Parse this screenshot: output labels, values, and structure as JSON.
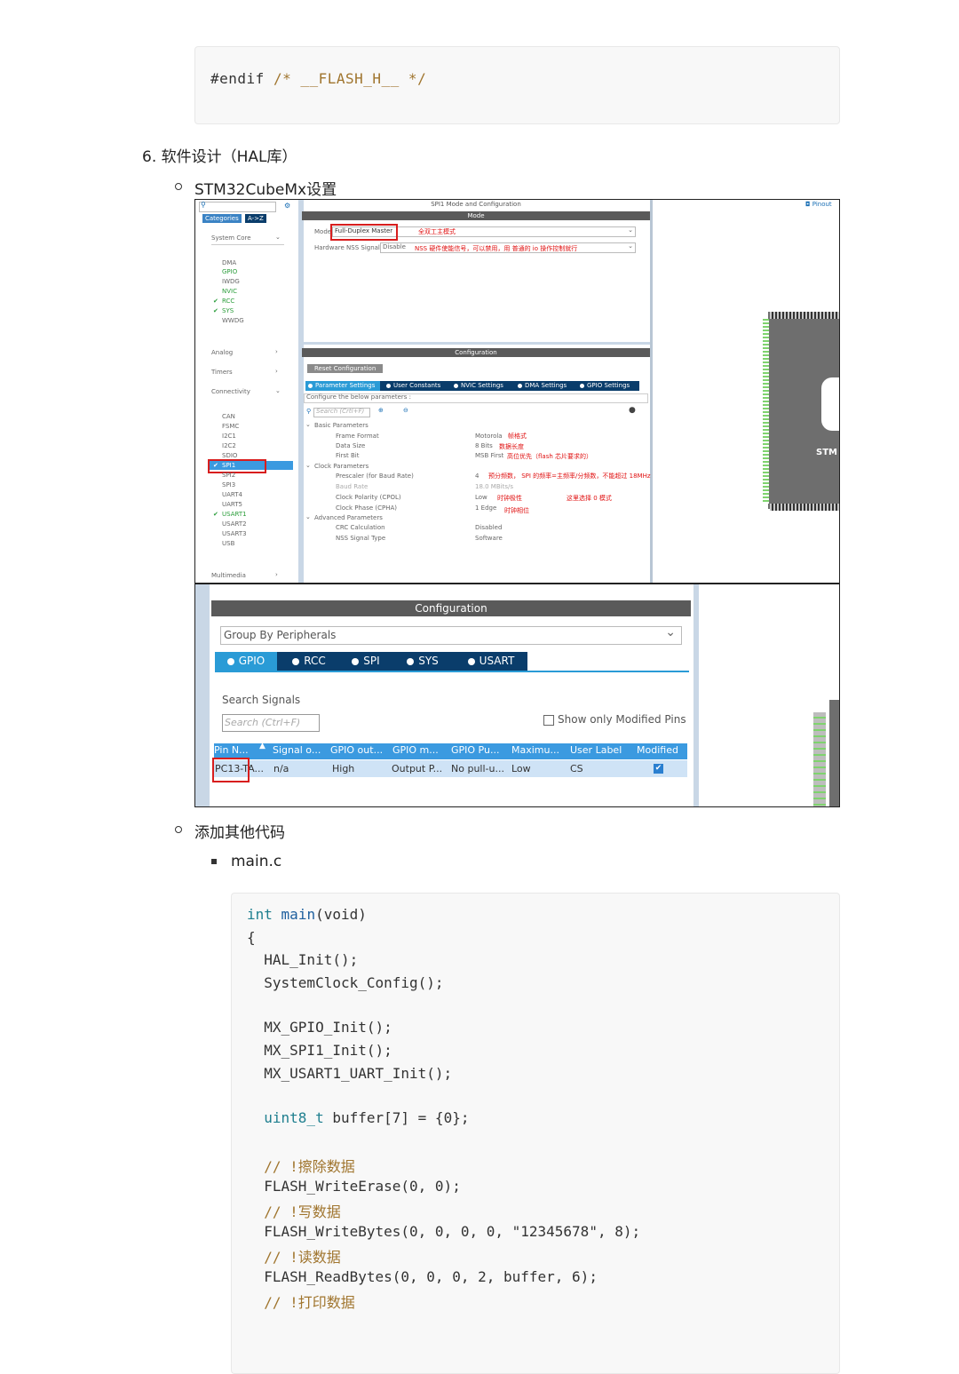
{
  "top_code": {
    "line": "#endif /* __FLASH_H__ */",
    "kw": "#endif",
    "comment": "/* __FLASH_H__ */"
  },
  "section": {
    "title": "6. 软件设计（HAL库）"
  },
  "sub1": {
    "label": "STM32CubeMx设置"
  },
  "shot1": {
    "search_icon": "search-icon",
    "cat_tabs": [
      "Categories",
      "A->Z"
    ],
    "groups": [
      "System Core",
      "Analog",
      "Timers",
      "Connectivity",
      "Multimedia"
    ],
    "system_core_items": [
      "DMA",
      "GPIO",
      "IWDG",
      "NVIC",
      "RCC",
      "SYS",
      "WWDG"
    ],
    "connectivity_items": [
      "CAN",
      "FSMC",
      "I2C1",
      "I2C2",
      "SDIO",
      "SPI1",
      "SPI2",
      "SPI3",
      "UART4",
      "UART5",
      "USART1",
      "USART2",
      "USART3",
      "USB"
    ],
    "mode_title": "SPI1 Mode and Configuration",
    "mode_header": "Mode",
    "mode_label": "Mode",
    "mode_value": "Full-Duplex Master",
    "mode_note": "全双工主模式",
    "nss_label": "Hardware NSS Signal",
    "nss_value": "Disable",
    "nss_note": "NSS 硬件使能信号，可以禁用，用 普通的 io 操作控制就行",
    "config_header": "Configuration",
    "reset_btn": "Reset Configuration",
    "param_tabs": [
      "Parameter Settings",
      "User Constants",
      "NVIC Settings",
      "DMA Settings",
      "GPIO Settings"
    ],
    "configure_text": "Configure the below parameters :",
    "search_placeholder": "Search (Crtl+F)",
    "params": {
      "basic": "Basic Parameters",
      "frame_format": "Frame Format",
      "frame_format_v": "Motorola",
      "frame_format_n": "帧格式",
      "data_size": "Data Size",
      "data_size_v": "8 Bits",
      "data_size_n": "数据长度",
      "first_bit": "First Bit",
      "first_bit_v": "MSB First",
      "first_bit_n": "高位优先（flash 芯片要求的）",
      "clock": "Clock Parameters",
      "prescaler": "Prescaler (for Baud Rate)",
      "prescaler_v": "4",
      "prescaler_n": "预分频数，  SPI 的频率=主频率/分频数，不能超过 18MHz",
      "baud": "Baud Rate",
      "baud_v": "18.0 MBits/s",
      "cpol": "Clock Polarity (CPOL)",
      "cpol_v": "Low",
      "cpol_n": "时钟极性",
      "cpha": "Clock Phase (CPHA)",
      "cpha_v": "1 Edge",
      "cpha_n": "时钟相位",
      "mode0_n": "这里选择 0 模式",
      "advanced": "Advanced Parameters",
      "crc": "CRC Calculation",
      "crc_v": "Disabled",
      "nss_type": "NSS Signal Type",
      "nss_type_v": "Software"
    },
    "pinout": "Pinout",
    "chip_text": "STM"
  },
  "shot2": {
    "header": "Configuration",
    "group_by": "Group By Peripherals",
    "tabs": [
      "GPIO",
      "RCC",
      "SPI",
      "SYS",
      "USART"
    ],
    "search_label": "Search Signals",
    "search_placeholder": "Search (Ctrl+F)",
    "show_modified": "Show only Modified Pins",
    "columns": [
      "Pin N...",
      "Signal o...",
      "GPIO out...",
      "GPIO m...",
      "GPIO Pu...",
      "Maximu...",
      "User Label",
      "Modified"
    ],
    "row": [
      "PC13-TA...",
      "n/a",
      "High",
      "Output P...",
      "No pull-u...",
      "Low",
      "CS",
      ""
    ]
  },
  "sub2": {
    "label": "添加其他代码"
  },
  "sub3": {
    "label": "main.c"
  },
  "main_code": {
    "l1_kw": "int",
    "l1_fn": "main",
    "l1_rest": "(void)",
    "l2": "{",
    "l3": "  HAL_Init();",
    "l4": "  SystemClock_Config();",
    "l5": "  MX_GPIO_Init();",
    "l6": "  MX_SPI1_Init();",
    "l7": "  MX_USART1_UART_Init();",
    "l8_kw": "uint8_t",
    "l8_rest": " buffer[7] = {0};",
    "c1": "// !擦除数据",
    "l9": "FLASH_WriteErase(0, 0);",
    "c2": "// !写数据",
    "l10": "FLASH_WriteBytes(0, 0, 0, 0, \"12345678\", 8);",
    "c3": "// !读数据",
    "l11": "FLASH_ReadBytes(0, 0, 0, 2, buffer, 6);",
    "c4": "// !打印数据"
  }
}
